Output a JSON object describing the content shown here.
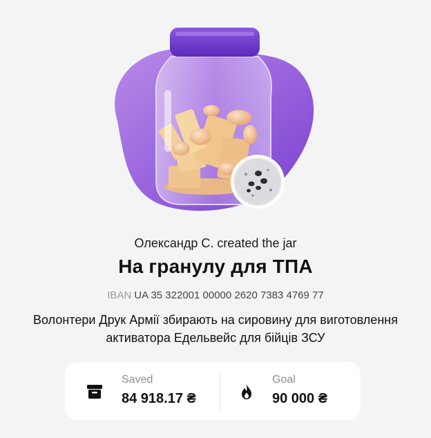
{
  "jar": {
    "creator_line": "Олександр С. created the jar",
    "title": "На гранулу для ТПА",
    "iban_label": "IBAN",
    "iban_value": "UA 35 322001 00000 2620 7383 4769 77",
    "description": "Волонтери Друк Армії збирають на сировину для виготовлення активатора Едельвейс для бійців ЗСУ"
  },
  "stats": {
    "saved": {
      "label": "Saved",
      "value": "84 918.17 ₴",
      "icon": "piggy-box-icon"
    },
    "goal": {
      "label": "Goal",
      "value": "90 000 ₴",
      "icon": "flame-icon"
    },
    "progress_fraction": 0.9435
  },
  "colors": {
    "background": "#f4f4f5",
    "accent_purple": "#8a4fd6",
    "lid_purple": "#6a32c9",
    "card": "#ffffff"
  }
}
